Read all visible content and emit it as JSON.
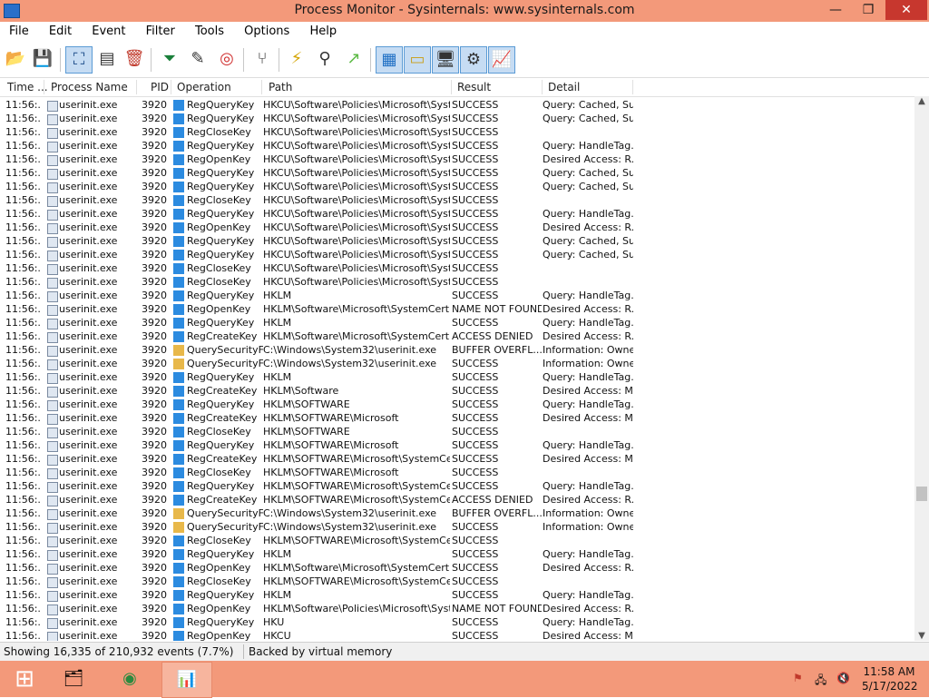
{
  "window": {
    "title": "Process Monitor - Sysinternals: www.sysinternals.com",
    "controls": {
      "minimize": "—",
      "maximize": "❐",
      "close": "✕"
    }
  },
  "menu": [
    "File",
    "Edit",
    "Event",
    "Filter",
    "Tools",
    "Options",
    "Help"
  ],
  "toolbar": {
    "buttons": [
      {
        "icon": "open-folder-icon",
        "glyph": "📂"
      },
      {
        "icon": "save-icon",
        "glyph": "💾"
      },
      {
        "icon": "capture-icon",
        "glyph": "⛶"
      },
      {
        "icon": "autoscroll-icon",
        "glyph": "▤"
      },
      {
        "icon": "clear-icon",
        "glyph": "🗑"
      },
      {
        "icon": "filter-icon",
        "glyph": "⏷"
      },
      {
        "icon": "edit-filter-icon",
        "glyph": "✎"
      },
      {
        "icon": "target-icon",
        "glyph": "◎"
      },
      {
        "icon": "process-tree-icon",
        "glyph": "⑂"
      },
      {
        "icon": "lightning-icon",
        "glyph": "⚡"
      },
      {
        "icon": "find-icon",
        "glyph": "⚲"
      },
      {
        "icon": "jump-icon",
        "glyph": "↗"
      },
      {
        "icon": "registry-activity-icon",
        "glyph": "▦"
      },
      {
        "icon": "filesystem-activity-icon",
        "glyph": "▭"
      },
      {
        "icon": "network-activity-icon",
        "glyph": "🖥"
      },
      {
        "icon": "process-activity-icon",
        "glyph": "⚙"
      },
      {
        "icon": "profiling-activity-icon",
        "glyph": "📈"
      }
    ]
  },
  "columns": {
    "time": "Time ...",
    "process": "Process Name",
    "pid": "PID",
    "operation": "Operation",
    "path": "Path",
    "result": "Result",
    "detail": "Detail"
  },
  "rows": [
    {
      "time": "11:56:...",
      "process": "userinit.exe",
      "pid": "3920",
      "op": "RegQueryKey",
      "path": "HKCU\\Software\\Policies\\Microsoft\\Syste...",
      "result": "SUCCESS",
      "detail": "Query: Cached, Su...",
      "kind": "reg"
    },
    {
      "time": "11:56:...",
      "process": "userinit.exe",
      "pid": "3920",
      "op": "RegQueryKey",
      "path": "HKCU\\Software\\Policies\\Microsoft\\Syste...",
      "result": "SUCCESS",
      "detail": "Query: Cached, Su...",
      "kind": "reg"
    },
    {
      "time": "11:56:...",
      "process": "userinit.exe",
      "pid": "3920",
      "op": "RegCloseKey",
      "path": "HKCU\\Software\\Policies\\Microsoft\\Syste...",
      "result": "SUCCESS",
      "detail": "",
      "kind": "reg"
    },
    {
      "time": "11:56:...",
      "process": "userinit.exe",
      "pid": "3920",
      "op": "RegQueryKey",
      "path": "HKCU\\Software\\Policies\\Microsoft\\Syste...",
      "result": "SUCCESS",
      "detail": "Query: HandleTag...",
      "kind": "reg"
    },
    {
      "time": "11:56:...",
      "process": "userinit.exe",
      "pid": "3920",
      "op": "RegOpenKey",
      "path": "HKCU\\Software\\Policies\\Microsoft\\Syste...",
      "result": "SUCCESS",
      "detail": "Desired Access: R...",
      "kind": "reg"
    },
    {
      "time": "11:56:...",
      "process": "userinit.exe",
      "pid": "3920",
      "op": "RegQueryKey",
      "path": "HKCU\\Software\\Policies\\Microsoft\\Syste...",
      "result": "SUCCESS",
      "detail": "Query: Cached, Su...",
      "kind": "reg"
    },
    {
      "time": "11:56:...",
      "process": "userinit.exe",
      "pid": "3920",
      "op": "RegQueryKey",
      "path": "HKCU\\Software\\Policies\\Microsoft\\Syste...",
      "result": "SUCCESS",
      "detail": "Query: Cached, Su...",
      "kind": "reg"
    },
    {
      "time": "11:56:...",
      "process": "userinit.exe",
      "pid": "3920",
      "op": "RegCloseKey",
      "path": "HKCU\\Software\\Policies\\Microsoft\\Syste...",
      "result": "SUCCESS",
      "detail": "",
      "kind": "reg"
    },
    {
      "time": "11:56:...",
      "process": "userinit.exe",
      "pid": "3920",
      "op": "RegQueryKey",
      "path": "HKCU\\Software\\Policies\\Microsoft\\Syste...",
      "result": "SUCCESS",
      "detail": "Query: HandleTag...",
      "kind": "reg"
    },
    {
      "time": "11:56:...",
      "process": "userinit.exe",
      "pid": "3920",
      "op": "RegOpenKey",
      "path": "HKCU\\Software\\Policies\\Microsoft\\Syste...",
      "result": "SUCCESS",
      "detail": "Desired Access: R...",
      "kind": "reg"
    },
    {
      "time": "11:56:...",
      "process": "userinit.exe",
      "pid": "3920",
      "op": "RegQueryKey",
      "path": "HKCU\\Software\\Policies\\Microsoft\\Syste...",
      "result": "SUCCESS",
      "detail": "Query: Cached, Su...",
      "kind": "reg"
    },
    {
      "time": "11:56:...",
      "process": "userinit.exe",
      "pid": "3920",
      "op": "RegQueryKey",
      "path": "HKCU\\Software\\Policies\\Microsoft\\Syste...",
      "result": "SUCCESS",
      "detail": "Query: Cached, Su...",
      "kind": "reg"
    },
    {
      "time": "11:56:...",
      "process": "userinit.exe",
      "pid": "3920",
      "op": "RegCloseKey",
      "path": "HKCU\\Software\\Policies\\Microsoft\\Syste...",
      "result": "SUCCESS",
      "detail": "",
      "kind": "reg"
    },
    {
      "time": "11:56:...",
      "process": "userinit.exe",
      "pid": "3920",
      "op": "RegCloseKey",
      "path": "HKCU\\Software\\Policies\\Microsoft\\Syste...",
      "result": "SUCCESS",
      "detail": "",
      "kind": "reg"
    },
    {
      "time": "11:56:...",
      "process": "userinit.exe",
      "pid": "3920",
      "op": "RegQueryKey",
      "path": "HKLM",
      "result": "SUCCESS",
      "detail": "Query: HandleTag...",
      "kind": "reg"
    },
    {
      "time": "11:56:...",
      "process": "userinit.exe",
      "pid": "3920",
      "op": "RegOpenKey",
      "path": "HKLM\\Software\\Microsoft\\SystemCertific...",
      "result": "NAME NOT FOUND",
      "detail": "Desired Access: R...",
      "kind": "reg"
    },
    {
      "time": "11:56:...",
      "process": "userinit.exe",
      "pid": "3920",
      "op": "RegQueryKey",
      "path": "HKLM",
      "result": "SUCCESS",
      "detail": "Query: HandleTag...",
      "kind": "reg"
    },
    {
      "time": "11:56:...",
      "process": "userinit.exe",
      "pid": "3920",
      "op": "RegCreateKey",
      "path": "HKLM\\Software\\Microsoft\\SystemCertific...",
      "result": "ACCESS DENIED",
      "detail": "Desired Access: R...",
      "kind": "reg"
    },
    {
      "time": "11:56:...",
      "process": "userinit.exe",
      "pid": "3920",
      "op": "QuerySecurityFile",
      "path": "C:\\Windows\\System32\\userinit.exe",
      "result": "BUFFER OVERFL...",
      "detail": "Information: Owner",
      "kind": "file"
    },
    {
      "time": "11:56:...",
      "process": "userinit.exe",
      "pid": "3920",
      "op": "QuerySecurityFile",
      "path": "C:\\Windows\\System32\\userinit.exe",
      "result": "SUCCESS",
      "detail": "Information: Owner",
      "kind": "file"
    },
    {
      "time": "11:56:...",
      "process": "userinit.exe",
      "pid": "3920",
      "op": "RegQueryKey",
      "path": "HKLM",
      "result": "SUCCESS",
      "detail": "Query: HandleTag...",
      "kind": "reg"
    },
    {
      "time": "11:56:...",
      "process": "userinit.exe",
      "pid": "3920",
      "op": "RegCreateKey",
      "path": "HKLM\\Software",
      "result": "SUCCESS",
      "detail": "Desired Access: M...",
      "kind": "reg"
    },
    {
      "time": "11:56:...",
      "process": "userinit.exe",
      "pid": "3920",
      "op": "RegQueryKey",
      "path": "HKLM\\SOFTWARE",
      "result": "SUCCESS",
      "detail": "Query: HandleTag...",
      "kind": "reg"
    },
    {
      "time": "11:56:...",
      "process": "userinit.exe",
      "pid": "3920",
      "op": "RegCreateKey",
      "path": "HKLM\\SOFTWARE\\Microsoft",
      "result": "SUCCESS",
      "detail": "Desired Access: M...",
      "kind": "reg"
    },
    {
      "time": "11:56:...",
      "process": "userinit.exe",
      "pid": "3920",
      "op": "RegCloseKey",
      "path": "HKLM\\SOFTWARE",
      "result": "SUCCESS",
      "detail": "",
      "kind": "reg"
    },
    {
      "time": "11:56:...",
      "process": "userinit.exe",
      "pid": "3920",
      "op": "RegQueryKey",
      "path": "HKLM\\SOFTWARE\\Microsoft",
      "result": "SUCCESS",
      "detail": "Query: HandleTag...",
      "kind": "reg"
    },
    {
      "time": "11:56:...",
      "process": "userinit.exe",
      "pid": "3920",
      "op": "RegCreateKey",
      "path": "HKLM\\SOFTWARE\\Microsoft\\SystemCer...",
      "result": "SUCCESS",
      "detail": "Desired Access: M...",
      "kind": "reg"
    },
    {
      "time": "11:56:...",
      "process": "userinit.exe",
      "pid": "3920",
      "op": "RegCloseKey",
      "path": "HKLM\\SOFTWARE\\Microsoft",
      "result": "SUCCESS",
      "detail": "",
      "kind": "reg"
    },
    {
      "time": "11:56:...",
      "process": "userinit.exe",
      "pid": "3920",
      "op": "RegQueryKey",
      "path": "HKLM\\SOFTWARE\\Microsoft\\SystemCer...",
      "result": "SUCCESS",
      "detail": "Query: HandleTag...",
      "kind": "reg"
    },
    {
      "time": "11:56:...",
      "process": "userinit.exe",
      "pid": "3920",
      "op": "RegCreateKey",
      "path": "HKLM\\SOFTWARE\\Microsoft\\SystemCer...",
      "result": "ACCESS DENIED",
      "detail": "Desired Access: R...",
      "kind": "reg"
    },
    {
      "time": "11:56:...",
      "process": "userinit.exe",
      "pid": "3920",
      "op": "QuerySecurityFile",
      "path": "C:\\Windows\\System32\\userinit.exe",
      "result": "BUFFER OVERFL...",
      "detail": "Information: Owner",
      "kind": "file"
    },
    {
      "time": "11:56:...",
      "process": "userinit.exe",
      "pid": "3920",
      "op": "QuerySecurityFile",
      "path": "C:\\Windows\\System32\\userinit.exe",
      "result": "SUCCESS",
      "detail": "Information: Owner",
      "kind": "file"
    },
    {
      "time": "11:56:...",
      "process": "userinit.exe",
      "pid": "3920",
      "op": "RegCloseKey",
      "path": "HKLM\\SOFTWARE\\Microsoft\\SystemCer...",
      "result": "SUCCESS",
      "detail": "",
      "kind": "reg"
    },
    {
      "time": "11:56:...",
      "process": "userinit.exe",
      "pid": "3920",
      "op": "RegQueryKey",
      "path": "HKLM",
      "result": "SUCCESS",
      "detail": "Query: HandleTag...",
      "kind": "reg"
    },
    {
      "time": "11:56:...",
      "process": "userinit.exe",
      "pid": "3920",
      "op": "RegOpenKey",
      "path": "HKLM\\Software\\Microsoft\\SystemCertific...",
      "result": "SUCCESS",
      "detail": "Desired Access: R...",
      "kind": "reg"
    },
    {
      "time": "11:56:...",
      "process": "userinit.exe",
      "pid": "3920",
      "op": "RegCloseKey",
      "path": "HKLM\\SOFTWARE\\Microsoft\\SystemCer...",
      "result": "SUCCESS",
      "detail": "",
      "kind": "reg"
    },
    {
      "time": "11:56:...",
      "process": "userinit.exe",
      "pid": "3920",
      "op": "RegQueryKey",
      "path": "HKLM",
      "result": "SUCCESS",
      "detail": "Query: HandleTag...",
      "kind": "reg"
    },
    {
      "time": "11:56:...",
      "process": "userinit.exe",
      "pid": "3920",
      "op": "RegOpenKey",
      "path": "HKLM\\Software\\Policies\\Microsoft\\Syste...",
      "result": "NAME NOT FOUND",
      "detail": "Desired Access: R...",
      "kind": "reg"
    },
    {
      "time": "11:56:...",
      "process": "userinit.exe",
      "pid": "3920",
      "op": "RegQueryKey",
      "path": "HKU",
      "result": "SUCCESS",
      "detail": "Query: HandleTag...",
      "kind": "reg"
    },
    {
      "time": "11:56:...",
      "process": "userinit.exe",
      "pid": "3920",
      "op": "RegOpenKey",
      "path": "HKCU",
      "result": "SUCCESS",
      "detail": "Desired Access: M...",
      "kind": "reg"
    }
  ],
  "status": {
    "events": "Showing 16,335 of 210,932 events (7.7%)",
    "backing": "Backed by virtual memory"
  },
  "taskbar": {
    "start": "⊞",
    "apps": [
      {
        "icon": "file-explorer-icon",
        "glyph": "🗂"
      },
      {
        "icon": "chrome-icon",
        "glyph": "◉"
      },
      {
        "icon": "process-monitor-icon",
        "glyph": "📊"
      }
    ],
    "tray": [
      "⚑",
      "🖧",
      "🔇"
    ],
    "time": "11:58 AM",
    "date": "5/17/2022"
  }
}
